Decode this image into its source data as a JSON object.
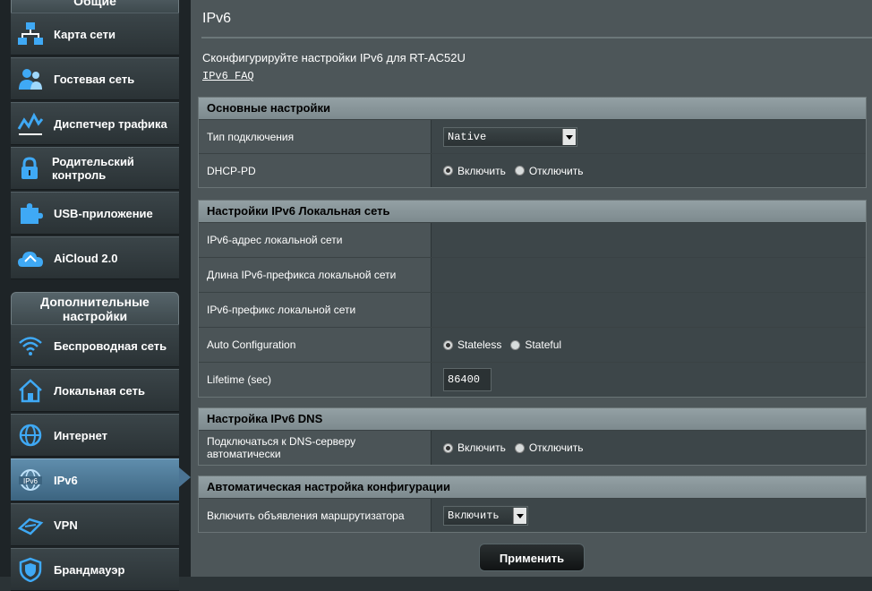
{
  "sidebar": {
    "general_header": "Общие",
    "advanced_header": "Дополнительные настройки",
    "general_items": [
      {
        "label": "Карта сети",
        "icon": "network-map-icon"
      },
      {
        "label": "Гостевая сеть",
        "icon": "guest-network-icon"
      },
      {
        "label": "Диспетчер трафика",
        "icon": "traffic-manager-icon"
      },
      {
        "label": "Родительский контроль",
        "icon": "lock-icon"
      },
      {
        "label": "USB-приложение",
        "icon": "puzzle-icon"
      },
      {
        "label": "AiCloud 2.0",
        "icon": "cloud-icon"
      }
    ],
    "advanced_items": [
      {
        "label": "Беспроводная сеть",
        "icon": "wifi-icon"
      },
      {
        "label": "Локальная сеть",
        "icon": "home-icon"
      },
      {
        "label": "Интернет",
        "icon": "globe-icon"
      },
      {
        "label": "IPv6",
        "icon": "ipv6-globe-icon"
      },
      {
        "label": "VPN",
        "icon": "vpn-icon"
      },
      {
        "label": "Брандмауэр",
        "icon": "shield-icon"
      }
    ]
  },
  "page": {
    "title": "IPv6",
    "description": "Сконфигурируйте настройки IPv6 для RT-AC52U",
    "faq_link": "IPv6 FAQ"
  },
  "basic": {
    "header": "Основные настройки",
    "connection_type_label": "Тип подключения",
    "connection_type_value": "Native",
    "dhcp_pd_label": "DHCP-PD",
    "dhcp_pd_enable": "Включить",
    "dhcp_pd_disable": "Отключить"
  },
  "lan": {
    "header": "Настройки IPv6 Локальная сеть",
    "address_label": "IPv6-адрес локальной сети",
    "prefix_length_label": "Длина IPv6-префикса локальной сети",
    "prefix_label": "IPv6-префикс локальной сети",
    "auto_config_label": "Auto Configuration",
    "auto_config_stateless": "Stateless",
    "auto_config_stateful": "Stateful",
    "lifetime_label": "Lifetime (sec)",
    "lifetime_value": "86400"
  },
  "dns": {
    "header": "Настройка IPv6 DNS",
    "auto_dns_label": "Подключаться к DNS-серверу автоматически",
    "enable": "Включить",
    "disable": "Отключить"
  },
  "autoconf": {
    "header": "Автоматическая настройка конфигурации",
    "router_adv_label": "Включить объявления маршрутизатора",
    "router_adv_value": "Включить"
  },
  "apply_button": "Применить",
  "colors": {
    "sidebar_active": "#4b7494",
    "table_header": "#8a979b",
    "main_bg": "#4d5659"
  }
}
